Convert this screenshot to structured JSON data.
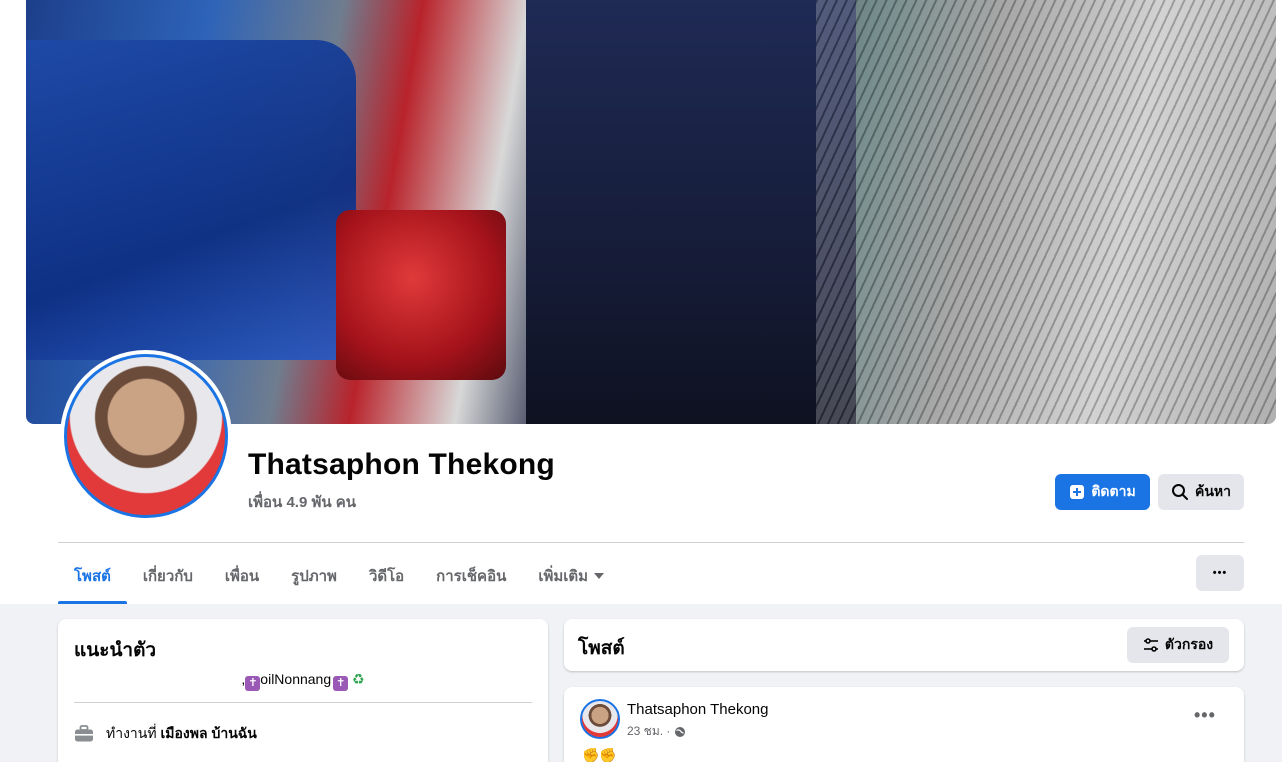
{
  "profile": {
    "name": "Thatsaphon Thekong",
    "friends": "เพื่อน 4.9 พัน คน"
  },
  "actions": {
    "follow_label": "ติดตาม",
    "search_label": "ค้นหา",
    "more_label": "•••"
  },
  "tabs": [
    {
      "label": "โพสต์",
      "active": true
    },
    {
      "label": "เกี่ยวกับ"
    },
    {
      "label": "เพื่อน"
    },
    {
      "label": "รูปภาพ"
    },
    {
      "label": "วิดีโอ"
    },
    {
      "label": "การเช็คอิน"
    },
    {
      "label": "เพิ่มเติม"
    }
  ],
  "intro": {
    "title": "แนะนำตัว",
    "bio_prefix": ",",
    "bio_cross": "✝",
    "bio_name": "oilNonnang",
    "bio_recycle": "♻",
    "work_prefix": "ทำงานที่",
    "work_place": "เมืองพล บ้านฉัน"
  },
  "posts": {
    "title": "โพสต์",
    "filter_label": "ตัวกรอง",
    "items": [
      {
        "author": "Thatsaphon Thekong",
        "time": "23 ชม. ·",
        "text": "✊✊",
        "more": "•••"
      }
    ]
  },
  "colors": {
    "accent": "#1b74e4",
    "secondary_button": "#e4e6eb",
    "page_bg": "#f0f2f5",
    "muted_text": "#65676b"
  }
}
